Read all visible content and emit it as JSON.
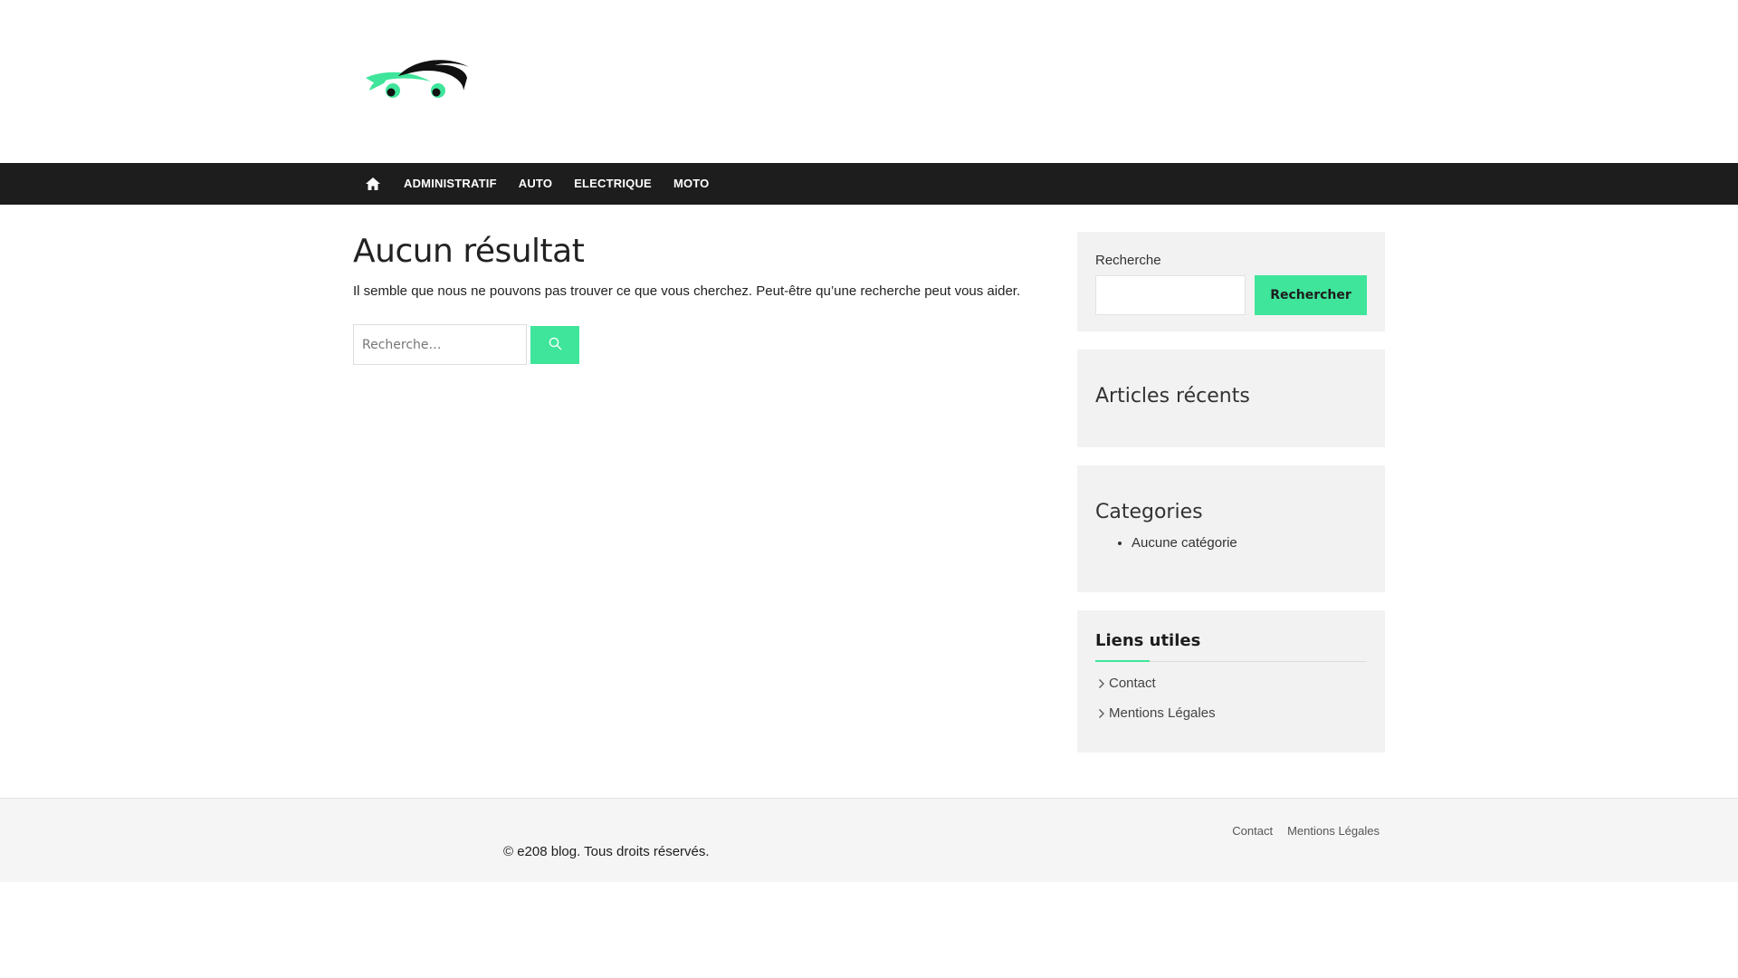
{
  "brand": {
    "logo_icon": "car-logo-icon",
    "accent_color": "#3ee59a",
    "nav_bg": "#1d1d1d"
  },
  "nav": {
    "home_icon": "home-icon",
    "items": [
      {
        "label": "ADMINISTRATIF"
      },
      {
        "label": "AUTO"
      },
      {
        "label": "ELECTRIQUE"
      },
      {
        "label": "MOTO"
      }
    ]
  },
  "main": {
    "title": "Aucun résultat",
    "description": "Il semble que nous ne pouvons pas trouver ce que vous cherchez. Peut-être qu’une recherche peut vous aider.",
    "search": {
      "placeholder": "Recherche…",
      "value": "",
      "button_icon": "search-icon"
    }
  },
  "sidebar": {
    "search": {
      "label": "Recherche",
      "input_value": "",
      "button_label": "Rechercher"
    },
    "recent": {
      "title": "Articles récents"
    },
    "categories": {
      "title": "Categories",
      "items": [
        "Aucune catégorie"
      ]
    },
    "links": {
      "title": "Liens utiles",
      "items": [
        "Contact",
        "Mentions Légales"
      ]
    }
  },
  "footer": {
    "copyright": "© e208 blog. Tous droits réservés.",
    "links": [
      "Contact",
      "Mentions Légales"
    ]
  }
}
